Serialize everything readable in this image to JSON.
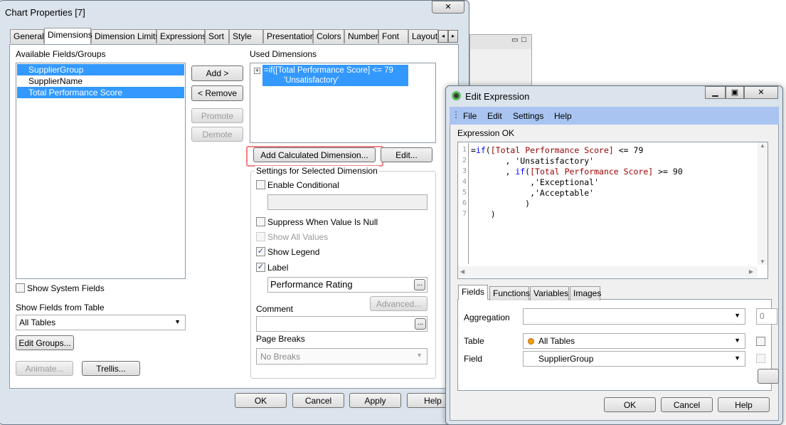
{
  "background_window": {
    "min": "▭",
    "max": "□"
  },
  "chart_properties": {
    "title": "Chart Properties [7]",
    "close_icon": "close-icon",
    "tabs": [
      "General",
      "Dimensions",
      "Dimension Limits",
      "Expressions",
      "Sort",
      "Style",
      "Presentation",
      "Colors",
      "Number",
      "Font",
      "Layout"
    ],
    "active_tab": "Dimensions",
    "available_label": "Available Fields/Groups",
    "available_fields": [
      "SupplierGroup",
      "SupplierName",
      "Total Performance Score"
    ],
    "selected_fields": [
      "SupplierGroup",
      "Total Performance Score"
    ],
    "add": "Add >",
    "remove": "< Remove",
    "promote": "Promote",
    "demote": "Demote",
    "used_label": "Used Dimensions",
    "used_dimension": "=if([Total Performance Score] <= 79",
    "used_dimension_line2": "'Unsatisfactory'",
    "add_calc": "Add Calculated Dimension...",
    "edit": "Edit...",
    "settings_title": "Settings for Selected Dimension",
    "enable_conditional": "Enable Conditional",
    "suppress_null": "Suppress When Value Is Null",
    "show_all_values": "Show All Values",
    "show_legend": "Show Legend",
    "label": "Label",
    "label_value": "Performance Rating",
    "ellipsis": "...",
    "advanced": "Advanced...",
    "comment": "Comment",
    "page_breaks": "Page Breaks",
    "page_breaks_value": "No Breaks",
    "show_system_fields": "Show System Fields",
    "show_fields_from": "Show Fields from Table",
    "table_value": "All Tables",
    "edit_groups": "Edit Groups...",
    "animate": "Animate...",
    "trellis": "Trellis...",
    "ok": "OK",
    "cancel": "Cancel",
    "apply": "Apply",
    "help": "Help"
  },
  "edit_expression": {
    "title": "Edit Expression",
    "menu": [
      "File",
      "Edit",
      "Settings",
      "Help"
    ],
    "status": "Expression OK",
    "line_numbers": [
      "1",
      "2",
      "3",
      "4",
      "5",
      "6",
      "7"
    ],
    "code": {
      "l1a": "=",
      "l1b": "if",
      "l1c": "(",
      "l1d": "[Total Performance Score]",
      "l1e": " <= 79",
      "l2": "       , 'Unsatisfactory'",
      "l3a": "       , ",
      "l3b": "if",
      "l3c": "(",
      "l3d": "[Total Performance Score]",
      "l3e": " >= 90",
      "l4": "            ,'Exceptional'",
      "l5": "            ,'Acceptable'",
      "l6": "           )",
      "l7": "    )"
    },
    "tabs": [
      "Fields",
      "Functions",
      "Variables",
      "Images"
    ],
    "active_tab": "Fields",
    "aggregation": "Aggregation",
    "aggregation_value": "",
    "table": "Table",
    "table_value": "All Tables",
    "field": "Field",
    "field_value": "SupplierGroup",
    "side_value": "0",
    "ok": "OK",
    "cancel": "Cancel",
    "help": "Help",
    "table_dot_color": "#f39c12"
  }
}
